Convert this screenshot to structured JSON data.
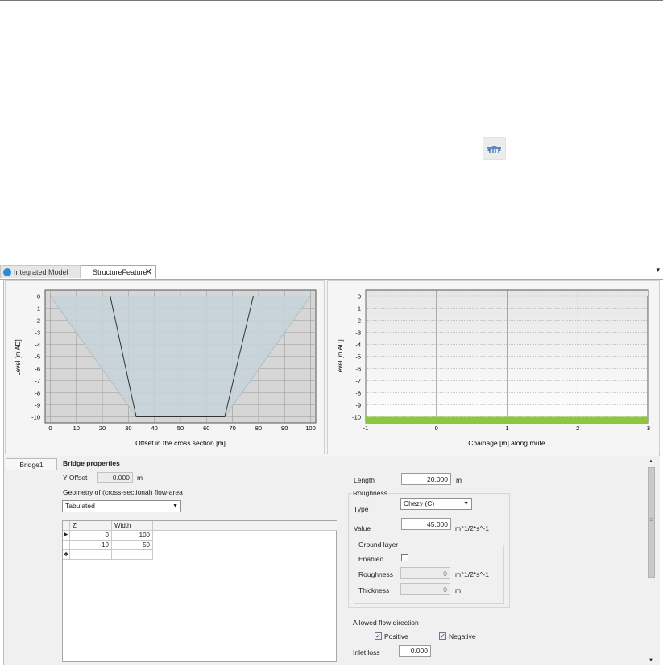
{
  "tabs": {
    "integrated_model": "Integrated Model",
    "structure_feature": "StructureFeature",
    "close": "✕",
    "menu": "▾"
  },
  "left_chart": {
    "ylabel": "Level [m AD]",
    "xlabel": "Offset in the cross section [m]",
    "x_ticks": [
      "0",
      "10",
      "20",
      "30",
      "40",
      "50",
      "60",
      "70",
      "80",
      "90",
      "100"
    ],
    "y_ticks": [
      "0",
      "-1",
      "-2",
      "-3",
      "-4",
      "-5",
      "-6",
      "-7",
      "-8",
      "-9",
      "-10"
    ]
  },
  "right_chart": {
    "ylabel": "Level [m AD]",
    "xlabel": "Chainage [m] along route",
    "x_ticks": [
      "-1",
      "0",
      "1",
      "2",
      "3"
    ],
    "y_ticks": [
      "0",
      "-1",
      "-2",
      "-3",
      "-4",
      "-5",
      "-6",
      "-7",
      "-8",
      "-9",
      "-10"
    ]
  },
  "chart_data": [
    {
      "type": "line",
      "xlabel": "Offset in the cross section [m]",
      "ylabel": "Level [m AD]",
      "xlim": [
        -2,
        102
      ],
      "ylim": [
        -10.5,
        0.5
      ],
      "series": [
        {
          "x": [
            0,
            23,
            33,
            67,
            78,
            100
          ],
          "y": [
            0,
            0,
            -10,
            -10,
            0,
            0
          ]
        }
      ],
      "flow_area": {
        "x": [
          0,
          33,
          67,
          100
        ],
        "y": [
          0,
          -10,
          -10,
          0
        ]
      }
    },
    {
      "type": "area",
      "xlabel": "Chainage [m] along route",
      "ylabel": "Level [m AD]",
      "xlim": [
        -1,
        3
      ],
      "ylim": [
        -10.5,
        0.5
      ],
      "series": [
        {
          "x": [
            -1,
            3
          ],
          "y": [
            0,
            0
          ],
          "color": "#c98a6a"
        },
        {
          "x": [
            -1,
            3
          ],
          "y": [
            -10,
            -10
          ],
          "color": "#8dc63f"
        }
      ]
    }
  ],
  "props": {
    "bridge_tab": "Bridge1",
    "section_title": "Bridge properties",
    "y_offset_label": "Y Offset",
    "y_offset_value": "0.000",
    "y_offset_unit": "m",
    "geometry_label": "Geometry of (cross-sectional) flow-area",
    "geometry_value": "Tabulated",
    "table": {
      "headers": [
        "Z",
        "Width"
      ],
      "rows": [
        [
          "0",
          "100"
        ],
        [
          "-10",
          "50"
        ]
      ],
      "current_marker": "▶",
      "new_marker": "✱"
    },
    "length_label": "Length",
    "length_value": "20.000",
    "length_unit": "m",
    "roughness_title": "Roughness",
    "type_label": "Type",
    "type_value": "Chezy (C)",
    "value_label": "Value",
    "value_value": "45.000",
    "value_unit": "m^1/2*s^-1",
    "ground_layer_title": "Ground layer",
    "enabled_label": "Enabled",
    "gl_roughness_label": "Roughness",
    "gl_roughness_value": "0",
    "gl_roughness_unit": "m^1/2*s^-1",
    "thickness_label": "Thickness",
    "thickness_value": "0",
    "thickness_unit": "m",
    "flow_direction_label": "Allowed flow direction",
    "positive_label": "Positive",
    "negative_label": "Negative",
    "inlet_loss_label": "Inlet loss",
    "inlet_loss_value": "0.000",
    "check_mark": "✓",
    "dropdown_arrow": "▼",
    "scroll_grip": "≡"
  },
  "colors": {
    "accent_green": "#8dc63f",
    "tab_globe": "#2b8bd4",
    "flow_area": "#c5d4da",
    "ground_line": "#c98a6a"
  }
}
